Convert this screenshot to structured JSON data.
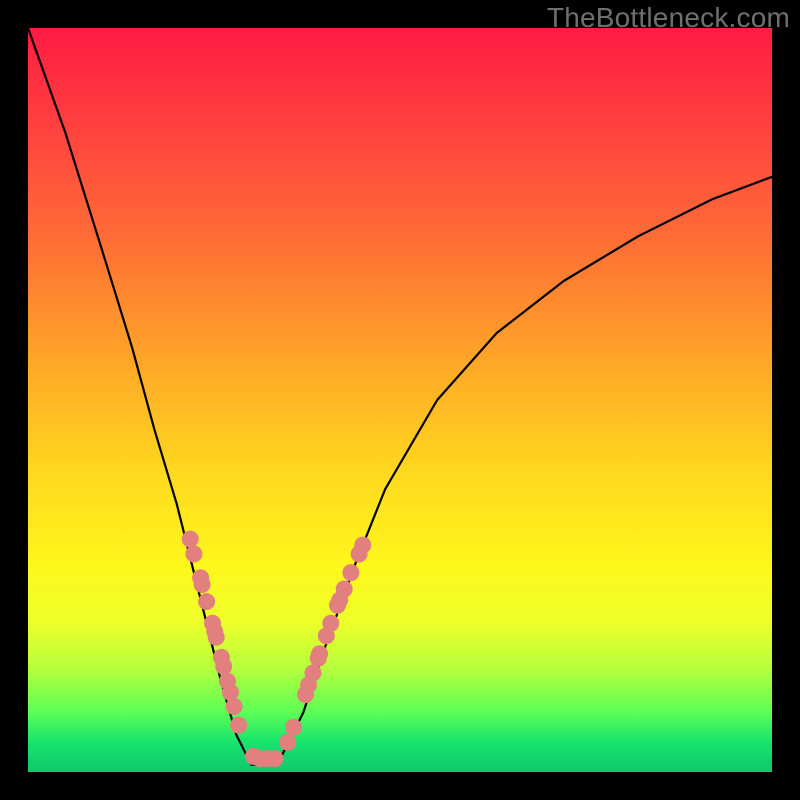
{
  "watermark": "TheBottleneck.com",
  "chart_data": {
    "type": "line",
    "title": "",
    "xlabel": "",
    "ylabel": "",
    "xlim": [
      0,
      1
    ],
    "ylim": [
      0,
      1
    ],
    "series": [
      {
        "name": "bottleneck-curve",
        "x": [
          0.0,
          0.05,
          0.1,
          0.14,
          0.17,
          0.2,
          0.22,
          0.24,
          0.26,
          0.28,
          0.3,
          0.32,
          0.34,
          0.37,
          0.4,
          0.44,
          0.48,
          0.55,
          0.63,
          0.72,
          0.82,
          0.92,
          1.0
        ],
        "y": [
          1.0,
          0.86,
          0.7,
          0.57,
          0.46,
          0.36,
          0.28,
          0.2,
          0.12,
          0.05,
          0.01,
          0.01,
          0.02,
          0.08,
          0.17,
          0.28,
          0.38,
          0.5,
          0.59,
          0.66,
          0.72,
          0.77,
          0.8
        ]
      }
    ],
    "markers": {
      "name": "sample-points",
      "color": "#e27f7f",
      "points": [
        {
          "x": 0.218,
          "y": 0.313
        },
        {
          "x": 0.223,
          "y": 0.293
        },
        {
          "x": 0.232,
          "y": 0.261
        },
        {
          "x": 0.234,
          "y": 0.252
        },
        {
          "x": 0.24,
          "y": 0.229
        },
        {
          "x": 0.248,
          "y": 0.2
        },
        {
          "x": 0.251,
          "y": 0.189
        },
        {
          "x": 0.253,
          "y": 0.181
        },
        {
          "x": 0.26,
          "y": 0.154
        },
        {
          "x": 0.263,
          "y": 0.142
        },
        {
          "x": 0.268,
          "y": 0.122
        },
        {
          "x": 0.272,
          "y": 0.107
        },
        {
          "x": 0.277,
          "y": 0.088
        },
        {
          "x": 0.283,
          "y": 0.063
        },
        {
          "x": 0.303,
          "y": 0.021
        },
        {
          "x": 0.312,
          "y": 0.018
        },
        {
          "x": 0.322,
          "y": 0.018
        },
        {
          "x": 0.332,
          "y": 0.018
        },
        {
          "x": 0.349,
          "y": 0.04
        },
        {
          "x": 0.357,
          "y": 0.06
        },
        {
          "x": 0.373,
          "y": 0.104
        },
        {
          "x": 0.377,
          "y": 0.117
        },
        {
          "x": 0.383,
          "y": 0.133
        },
        {
          "x": 0.39,
          "y": 0.153
        },
        {
          "x": 0.392,
          "y": 0.159
        },
        {
          "x": 0.401,
          "y": 0.183
        },
        {
          "x": 0.407,
          "y": 0.2
        },
        {
          "x": 0.416,
          "y": 0.224
        },
        {
          "x": 0.419,
          "y": 0.231
        },
        {
          "x": 0.425,
          "y": 0.246
        },
        {
          "x": 0.434,
          "y": 0.268
        },
        {
          "x": 0.445,
          "y": 0.293
        },
        {
          "x": 0.45,
          "y": 0.305
        }
      ]
    },
    "background_gradient": {
      "top": "#ff1b43",
      "bottom": "#0fc86b"
    }
  }
}
